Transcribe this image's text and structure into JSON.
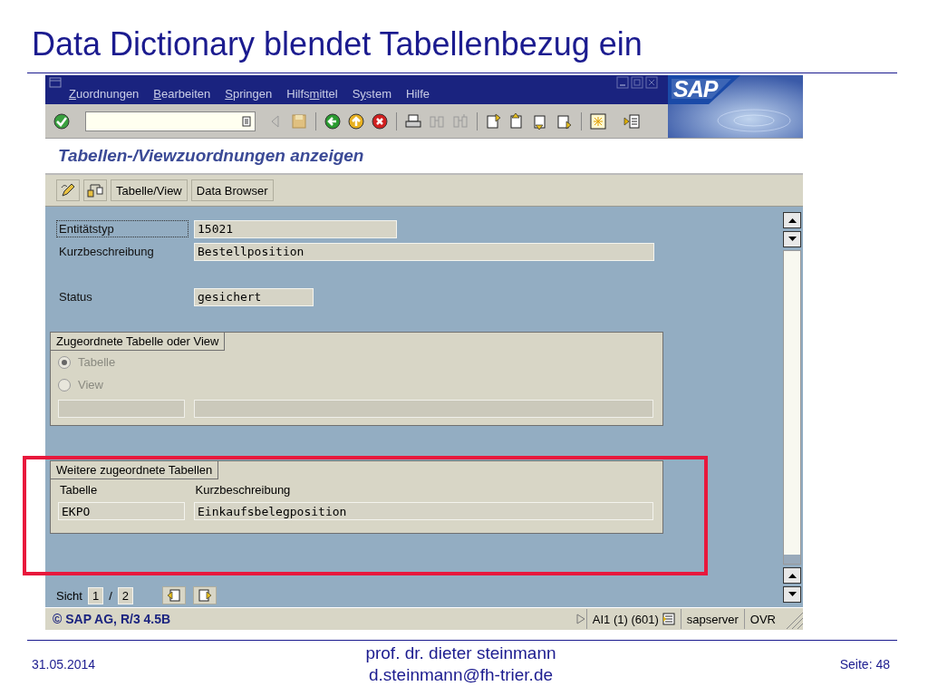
{
  "slide_title": "Data Dictionary blendet Tabellenbezug ein",
  "menu": [
    {
      "key": "Z",
      "after": "uordnungen"
    },
    {
      "key": "B",
      "after": "earbeiten"
    },
    {
      "key": "S",
      "after": "pringen"
    },
    {
      "before": "Hilfs",
      "key": "m",
      "after": "ittel"
    },
    {
      "before": "S",
      "key": "y",
      "after": "stem"
    },
    {
      "before": "Hilfe"
    }
  ],
  "logo": "SAP",
  "screen_title": "Tabellen-/Viewzuordnungen anzeigen",
  "app_buttons": [
    "Tabelle/View",
    "Data Browser"
  ],
  "fields": [
    {
      "kind": "field",
      "label": "Entitätstyp",
      "value": "15021",
      "focused": true
    },
    {
      "kind": "field",
      "label": "Kurzbeschreibung",
      "value": "Bestellposition",
      "focused": false
    },
    {
      "kind": "gap"
    },
    {
      "kind": "field",
      "label": "Status",
      "value": "gesichert",
      "focused": false
    }
  ],
  "group_assigned": {
    "title": "Zugeordnete Tabelle oder View",
    "radios": [
      {
        "label": "Tabelle",
        "selected": true,
        "disabled": true
      },
      {
        "label": "View",
        "selected": false,
        "disabled": true
      }
    ]
  },
  "group_more": {
    "title": "Weitere zugeordnete Tabellen",
    "columns": [
      "Tabelle",
      "Kurzbeschreibung"
    ],
    "rows": [
      [
        "EKPO",
        "Einkaufsbelegposition"
      ]
    ]
  },
  "pager": {
    "label": "Sicht",
    "current": "1",
    "separator": "/",
    "total": "2"
  },
  "status_bar": {
    "copyright": "© SAP AG, R/3 4.5B",
    "session": "AI1 (1) (601)",
    "server": "sapserver",
    "mode": "OVR"
  },
  "footer": {
    "date": "31.05.2014",
    "author": "prof. dr. dieter steinmann",
    "email": "d.steinmann@fh-trier.de",
    "page": "Seite: 48"
  }
}
